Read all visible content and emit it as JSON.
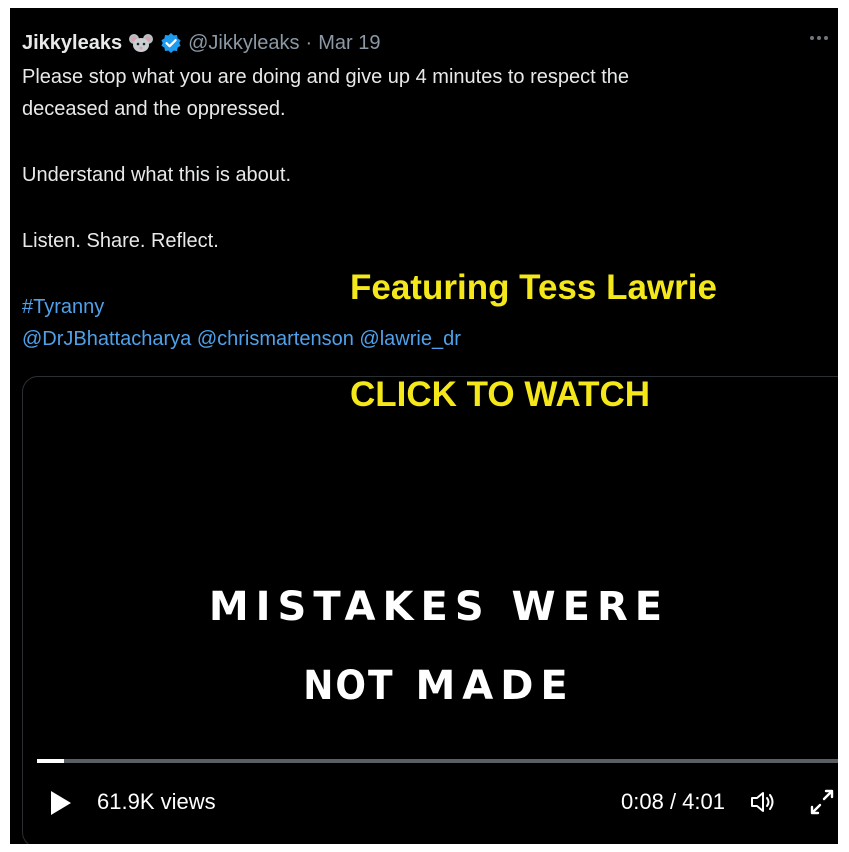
{
  "tweet": {
    "author_name": "Jikkyleaks",
    "author_handle": "@Jikkyleaks",
    "separator": "·",
    "date": "Mar 19",
    "text_lines": [
      "Please stop what you are doing and give up 4 minutes to respect the",
      "deceased and the oppressed.",
      "Understand what this is about.",
      "Listen. Share. Reflect."
    ],
    "hashtag": "#Tyranny",
    "mentions": [
      "@DrJBhattacharya",
      "@chrismartenson",
      "@lawrie_dr"
    ],
    "icons": {
      "author_badge": "mouse-icon",
      "verified": "verified-badge-icon",
      "more": "more-options-icon"
    }
  },
  "overlay": {
    "featuring": "Featuring Tess Lawrie",
    "cta": "CLICK TO WATCH",
    "color": "#f5e81a"
  },
  "video": {
    "title_line1": "MISTAKES WERE",
    "title_line2_word1": "NOT",
    "title_line2_word2": "MADE",
    "views": "61.9K views",
    "time": "0:08 / 4:01",
    "progress": 0.033,
    "icons": {
      "play": "play-icon",
      "volume": "volume-icon",
      "fullscreen": "fullscreen-icon"
    }
  },
  "colors": {
    "link": "#4ea1ea",
    "background": "#000000",
    "verified": "#1d9bf0"
  }
}
